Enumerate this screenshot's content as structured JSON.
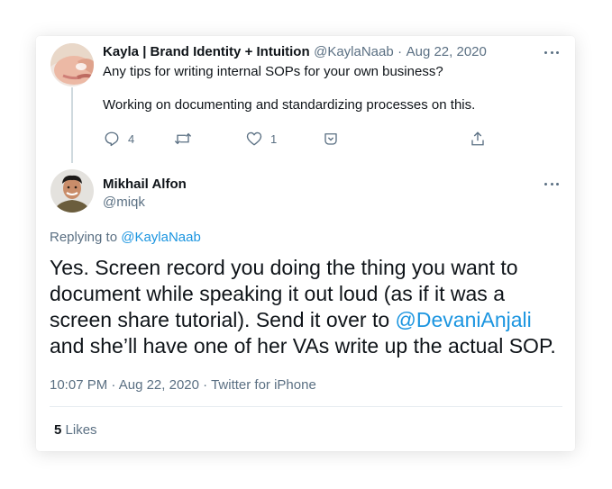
{
  "parent_tweet": {
    "display_name": "Kayla | Brand Identity + Intuition",
    "handle": "@KaylaNaab",
    "separator": "·",
    "date": "Aug 22, 2020",
    "line1": "Any tips for writing internal SOPs for your own business?",
    "line2": "Working on documenting and standardizing processes on this.",
    "reply_count": "4",
    "like_count": "1"
  },
  "reply_tweet": {
    "display_name": "Mikhail Alfon",
    "handle": "@miqk",
    "replying_prefix": "Replying to ",
    "replying_handle": "@KaylaNaab",
    "text_before_mention": "Yes. Screen record you doing the thing you want to document while speaking it out loud (as if it was a screen share tutorial). Send it over to ",
    "mention": "@DevaniAnjali",
    "text_after_mention": " and she’ll have one of her VAs write up the actual SOP.",
    "time": "10:07 PM",
    "dot1": "·",
    "date": "Aug 22, 2020",
    "dot2": "·",
    "source": "Twitter for iPhone",
    "likes_count": "5",
    "likes_label": "Likes"
  },
  "icons": [
    "reply-icon",
    "retweet-icon",
    "like-icon",
    "share-dm-icon",
    "share-icon",
    "more-icon"
  ],
  "colors": {
    "text": "#0f1419",
    "muted": "#5b7083",
    "link": "#1b95e0",
    "thread_line": "#cfd9de",
    "divider": "#e6ecf0"
  }
}
